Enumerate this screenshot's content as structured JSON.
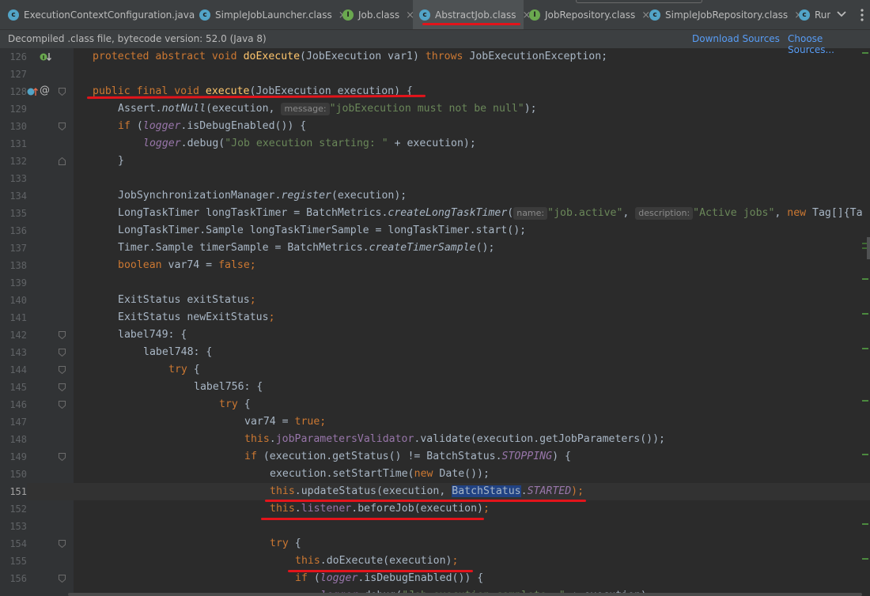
{
  "tabs": [
    {
      "label": "ExecutionContextConfiguration.java",
      "icon": "c",
      "active": false,
      "annotated": false
    },
    {
      "label": "SimpleJobLauncher.class",
      "icon": "c",
      "active": false,
      "annotated": false
    },
    {
      "label": "Job.class",
      "icon": "i",
      "active": false,
      "annotated": false
    },
    {
      "label": "AbstractJob.class",
      "icon": "c",
      "active": true,
      "annotated": true
    },
    {
      "label": "JobRepository.class",
      "icon": "i",
      "active": false,
      "annotated": false
    },
    {
      "label": "SimpleJobRepository.class",
      "icon": "c",
      "active": false,
      "annotated": false
    },
    {
      "label": "Run",
      "icon": "c",
      "active": false,
      "annotated": false
    }
  ],
  "tab_close_glyph": "×",
  "banner": {
    "message": "Decompiled .class file, bytecode version: 52.0 (Java 8)",
    "download_sources": "Download Sources",
    "choose_sources": "Choose Sources..."
  },
  "gutter_icons": {
    "line_126": "implementation-down-icon",
    "line_128": [
      "override-up-icon",
      "annotation-at-icon"
    ]
  },
  "caret_line": 151,
  "colors": {
    "keyword": "#cc7832",
    "method_decl": "#ffc66d",
    "string": "#6a8759",
    "field": "#9876aa",
    "plain": "#a9b7c6",
    "annotation_red": "#e3141b"
  },
  "code_lines": [
    {
      "n": "126",
      "indent": 4
    },
    {
      "n": "127",
      "indent": 0
    },
    {
      "n": "128",
      "indent": 4
    },
    {
      "n": "129",
      "indent": 8
    },
    {
      "n": "130",
      "indent": 8
    },
    {
      "n": "131",
      "indent": 12
    },
    {
      "n": "132",
      "indent": 8
    },
    {
      "n": "133",
      "indent": 0
    },
    {
      "n": "134",
      "indent": 8
    },
    {
      "n": "135",
      "indent": 8
    },
    {
      "n": "136",
      "indent": 8
    },
    {
      "n": "137",
      "indent": 8
    },
    {
      "n": "138",
      "indent": 8
    },
    {
      "n": "139",
      "indent": 0
    },
    {
      "n": "140",
      "indent": 8
    },
    {
      "n": "141",
      "indent": 8
    },
    {
      "n": "142",
      "indent": 8
    },
    {
      "n": "143",
      "indent": 12
    },
    {
      "n": "144",
      "indent": 16
    },
    {
      "n": "145",
      "indent": 20
    },
    {
      "n": "146",
      "indent": 24
    },
    {
      "n": "147",
      "indent": 28
    },
    {
      "n": "148",
      "indent": 28
    },
    {
      "n": "149",
      "indent": 28
    },
    {
      "n": "150",
      "indent": 32
    },
    {
      "n": "151",
      "indent": 32
    },
    {
      "n": "152",
      "indent": 32
    },
    {
      "n": "153",
      "indent": 0
    },
    {
      "n": "154",
      "indent": 32
    },
    {
      "n": "155",
      "indent": 36
    },
    {
      "n": "156",
      "indent": 36
    }
  ],
  "tokens": {
    "l126": [
      "protected abstract void ",
      "doExecute",
      "(JobExecution var1) ",
      "throws ",
      "JobExecutionException;"
    ],
    "l128": [
      "public final void ",
      "execute",
      "(JobExecution execution) {"
    ],
    "l129": [
      "Assert.",
      "notNull",
      "(execution, ",
      "message:",
      "\"jobExecution must not be null\"",
      ");"
    ],
    "l130": [
      "if ",
      "(",
      "logger",
      ".isDebugEnabled()) {"
    ],
    "l131": [
      "logger",
      ".debug(",
      "\"Job execution starting: \"",
      " + execution);"
    ],
    "l132": [
      "}"
    ],
    "l134": [
      "JobSynchronizationManager.",
      "register",
      "(execution);"
    ],
    "l135": [
      "LongTaskTimer longTaskTimer = BatchMetrics.",
      "createLongTaskTimer",
      "(",
      "name:",
      "\"job.active\"",
      ", ",
      "description:",
      "\"Active jobs\"",
      ", ",
      "new ",
      "Tag[]{Ta"
    ],
    "l136": [
      "LongTaskTimer.Sample longTaskTimerSample = longTaskTimer.start();"
    ],
    "l137": [
      "Timer.Sample timerSample = BatchMetrics.",
      "createTimerSample",
      "();"
    ],
    "l138": [
      "boolean ",
      "var74 = ",
      "false",
      ";"
    ],
    "l140": [
      "ExitStatus exitStatus",
      ";"
    ],
    "l141": [
      "ExitStatus newExitStatus",
      ";"
    ],
    "l142": [
      "label749: {"
    ],
    "l143": [
      "label748: {"
    ],
    "l144": [
      "try ",
      "{"
    ],
    "l145": [
      "label756: {"
    ],
    "l146": [
      "try ",
      "{"
    ],
    "l147": [
      "var74 = ",
      "true",
      ";"
    ],
    "l148": [
      "this",
      ".",
      "jobParametersValidator",
      ".validate(execution.getJobParameters());"
    ],
    "l149": [
      "if ",
      "(execution.getStatus() != BatchStatus.",
      "STOPPING",
      ") {"
    ],
    "l150": [
      "execution.setStartTime(",
      "new ",
      "Date());"
    ],
    "l151": [
      "this",
      ".updateStatus(execution, ",
      "BatchStatus",
      ".",
      "STARTED",
      ");"
    ],
    "l152": [
      "this",
      ".",
      "listener",
      ".beforeJob(execution)",
      ";"
    ],
    "l154": [
      "try ",
      "{"
    ],
    "l155": [
      "this",
      ".doExecute(execution)",
      ";"
    ],
    "l156": [
      "if ",
      "(",
      "logger",
      ".isDebugEnabled()) {"
    ],
    "l157": [
      "logger",
      ".debug(",
      "\"Job execution complete: \"",
      " + execution);"
    ]
  }
}
